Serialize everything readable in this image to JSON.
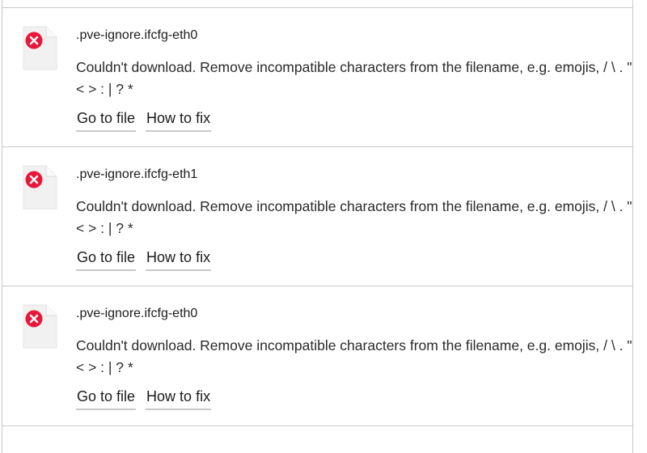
{
  "items": [
    {
      "filename": ".pve-ignore.ifcfg-eth0",
      "message": "Couldn't download. Remove incompatible characters from the filename, e.g. emojis, / \\ . \" < > : | ? *",
      "actions": {
        "go_to_file": "Go to file",
        "how_to_fix": "How to fix"
      }
    },
    {
      "filename": ".pve-ignore.ifcfg-eth1",
      "message": "Couldn't download. Remove incompatible characters from the filename, e.g. emojis, / \\ . \" < > : | ? *",
      "actions": {
        "go_to_file": "Go to file",
        "how_to_fix": "How to fix"
      }
    },
    {
      "filename": ".pve-ignore.ifcfg-eth0",
      "message": "Couldn't download. Remove incompatible characters from the filename, e.g. emojis, / \\ . \" < > : | ? *",
      "actions": {
        "go_to_file": "Go to file",
        "how_to_fix": "How to fix"
      }
    }
  ],
  "icons": {
    "file": "file-icon",
    "error": "error-x-icon"
  },
  "colors": {
    "error_red": "#e8173a",
    "border": "#c9c9c9",
    "file_icon_fill": "#f1f1f1"
  }
}
